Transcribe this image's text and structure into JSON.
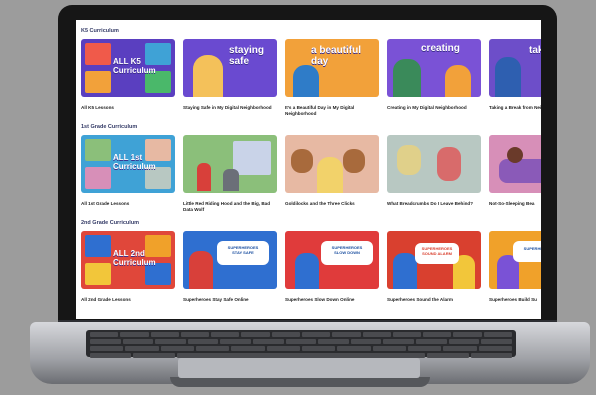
{
  "sections": [
    {
      "title": "K5 Curriculum",
      "cards": [
        {
          "label": "All K5 Lessons",
          "thumb_text": "ALL K5\nCurriculum",
          "color": "#5a3fc0"
        },
        {
          "label": "Staying Safe in My Digital Neighborhood",
          "thumb_text": "staying safe",
          "color": "#6a4ad0"
        },
        {
          "label": "It’s a Beautiful Day in My Digital Neighborhood",
          "thumb_text": "a beautiful day",
          "color": "#f2a13a"
        },
        {
          "label": "Creating in My Digital Neighborhood",
          "thumb_text": "creating",
          "color": "#7a52d6"
        },
        {
          "label": "Taking a Break from Neighborhood",
          "thumb_text": "tak",
          "color": "#6d4ec9"
        }
      ]
    },
    {
      "title": "1st Grade Curriculum",
      "cards": [
        {
          "label": "All 1st Grade Lessons",
          "thumb_text": "ALL 1st\nCurriculum",
          "color": "#3fa2d6"
        },
        {
          "label": "Little Red Riding Hood and the Big, Bad Data Wolf",
          "thumb_text": "",
          "color": "#8bbf7a"
        },
        {
          "label": "Goldilocks and the Three Clicks",
          "thumb_text": "",
          "color": "#e7b9a3"
        },
        {
          "label": "What Breadcrumbs Do I Leave Behind?",
          "thumb_text": "",
          "color": "#b8c8c2"
        },
        {
          "label": "Not-So-Sleeping Bea",
          "thumb_text": "",
          "color": "#d78fb8"
        }
      ]
    },
    {
      "title": "2nd Grade Curriculum",
      "cards": [
        {
          "label": "All 2nd Grade Lessons",
          "thumb_text": "ALL 2nd\nCurriculum",
          "color": "#e0473a"
        },
        {
          "label": "Superheroes Stay Safe Online",
          "thumb_text": "SUPERHEROES\nSTAY SAFE",
          "color": "#2f6fd0"
        },
        {
          "label": "Superheroes Slow Down Online",
          "thumb_text": "SUPERHEROES\nSLOW DOWN",
          "color": "#e03b3b"
        },
        {
          "label": "Superheroes Sound the Alarm",
          "thumb_text": "SUPERHEROES\nSOUND ALARM",
          "color": "#d9402f"
        },
        {
          "label": "Superheroes Build Su",
          "thumb_text": "SUPERHEROES",
          "color": "#f0a12a"
        }
      ]
    }
  ]
}
